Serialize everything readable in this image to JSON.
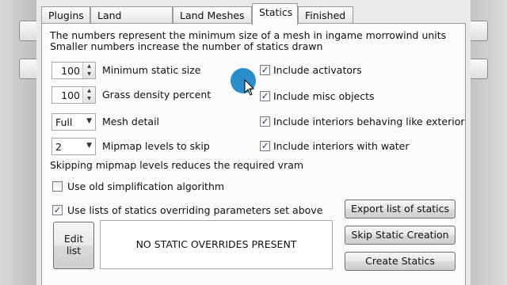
{
  "tabs": [
    {
      "label": "Plugins"
    },
    {
      "label": "Land Textures"
    },
    {
      "label": "Land Meshes"
    },
    {
      "label": "Statics"
    },
    {
      "label": "Finished"
    }
  ],
  "active_tab": "Statics",
  "info": {
    "line1": "The numbers represent the minimum size of a mesh in ingame morrowind units",
    "line2": "Smaller numbers increase the number of statics drawn"
  },
  "settings": {
    "min_static_size": {
      "value": "100",
      "label": "Minimum static size"
    },
    "grass_density": {
      "value": "100",
      "label": "Grass density percent"
    },
    "mesh_detail": {
      "value": "Full",
      "label": "Mesh detail"
    },
    "mipmap_levels": {
      "value": "2",
      "label": "Mipmap levels to skip"
    },
    "mipmap_note": "Skipping mipmap levels reduces the required vram"
  },
  "checkboxes": {
    "include_activators": {
      "label": "Include activators",
      "checked": true
    },
    "include_misc": {
      "label": "Include misc objects",
      "checked": true
    },
    "include_interiors_exterior": {
      "label": "Include interiors behaving like exterior",
      "checked": true
    },
    "include_interiors_water": {
      "label": "Include interiors with water",
      "checked": true
    },
    "old_simplification": {
      "label": "Use old simplification algorithm",
      "checked": false
    },
    "use_lists": {
      "label": "Use lists of statics overriding parameters set above",
      "checked": true
    }
  },
  "buttons": {
    "edit_list": "Edit list",
    "export_list": "Export list of statics",
    "skip_static": "Skip Static Creation",
    "create_statics": "Create Statics"
  },
  "overrides_text": "NO STATIC OVERRIDES PRESENT",
  "colors": {
    "cursor_highlight": "#1e88c8",
    "check_mark": "#1a2a6a"
  },
  "check_glyph": "✓"
}
